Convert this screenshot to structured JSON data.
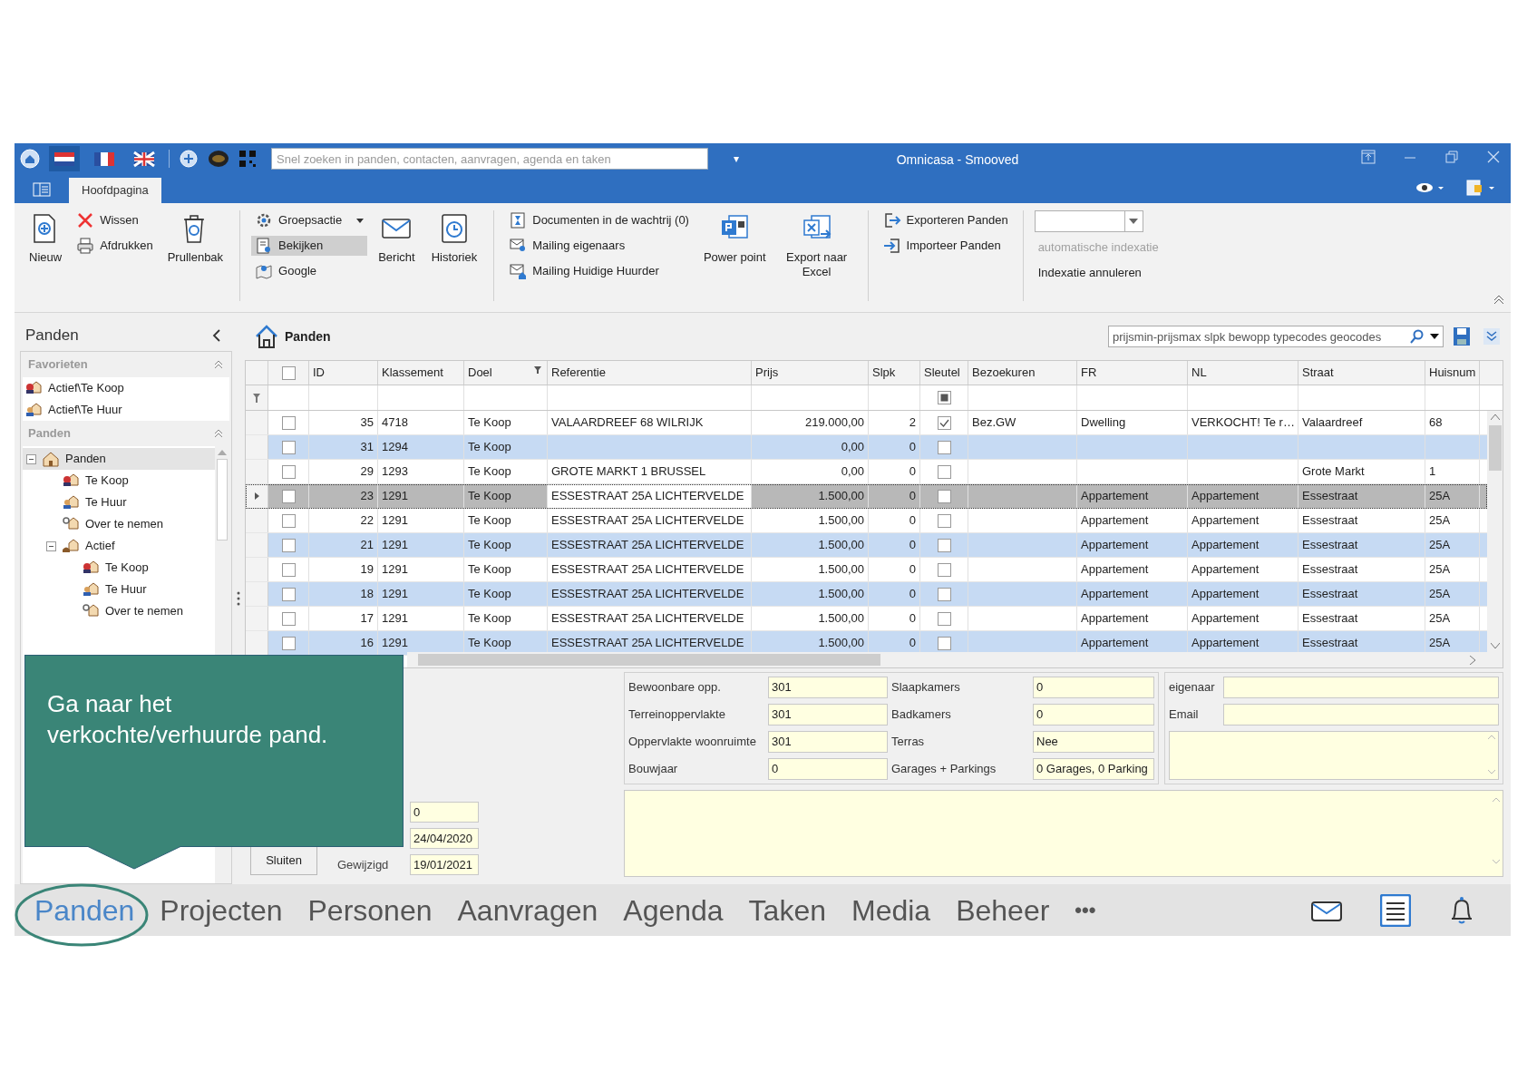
{
  "title_bar": {
    "title": "Omnicasa - Smooved",
    "languages": [
      {
        "kind": "nl",
        "selected": true
      },
      {
        "kind": "fr",
        "selected": false
      },
      {
        "kind": "uk",
        "selected": false
      }
    ],
    "search": {
      "placeholder": "Snel zoeken in panden, contacten, aanvragen, agenda en taken"
    },
    "dropdown": "▾"
  },
  "ribbon": {
    "tabs": [
      {
        "label": "Hoofdpagina",
        "selected": true
      }
    ],
    "groups": [
      {
        "items": [
          {
            "label": "Nieuw",
            "kind": "large",
            "pressed": false,
            "disabled": false
          },
          {
            "label": "Wissen",
            "kind": "small",
            "pressed": false,
            "disabled": false
          },
          {
            "label": "Afdrukken",
            "kind": "small",
            "pressed": false,
            "disabled": false
          },
          {
            "label": "Prullenbak",
            "kind": "large",
            "pressed": false,
            "disabled": false
          }
        ]
      },
      {
        "items": [
          {
            "label": "Groepsactie",
            "kind": "split",
            "pressed": false,
            "disabled": false
          },
          {
            "label": "Bekijken",
            "kind": "small",
            "pressed": true,
            "disabled": false
          },
          {
            "label": "Google",
            "kind": "small",
            "pressed": false,
            "disabled": false
          },
          {
            "label": "Bericht",
            "kind": "large",
            "pressed": false,
            "disabled": false
          },
          {
            "label": "Historiek",
            "kind": "large",
            "pressed": false,
            "disabled": false
          }
        ]
      },
      {
        "items": [
          {
            "label": "Documenten in de wachtrij (0)",
            "kind": "small",
            "pressed": false,
            "disabled": false
          },
          {
            "label": "Mailing eigenaars",
            "kind": "small",
            "pressed": false,
            "disabled": false
          },
          {
            "label": "Mailing Huidige Huurder",
            "kind": "small",
            "pressed": false,
            "disabled": false
          },
          {
            "label": "Power point",
            "kind": "large",
            "pressed": false,
            "disabled": false
          },
          {
            "label": "Export naar Excel",
            "kind": "large",
            "pressed": false,
            "disabled": false
          }
        ]
      },
      {
        "items": [
          {
            "label": "Exporteren Panden",
            "kind": "small",
            "pressed": false,
            "disabled": false
          },
          {
            "label": "Importeer Panden",
            "kind": "small",
            "pressed": false,
            "disabled": false
          }
        ]
      },
      {
        "items": [
          {
            "kind": "combo",
            "pressed": false,
            "disabled": false
          },
          {
            "label": "automatische indexatie",
            "kind": "small",
            "pressed": false,
            "disabled": true
          },
          {
            "label": "Indexatie annuleren",
            "kind": "small",
            "pressed": false,
            "disabled": false
          }
        ]
      }
    ]
  },
  "sidebar": {
    "title": "Panden",
    "favorites": {
      "title": "Favorieten",
      "items": [
        {
          "label": "Actief\\Te Koop",
          "kind": "sale"
        },
        {
          "label": "Actief\\Te Huur",
          "kind": "rent"
        }
      ]
    },
    "tree_section": {
      "title": "Panden",
      "tree": [
        {
          "label": "Panden",
          "kind": "home",
          "selected": true,
          "expanded": true,
          "children": [
            {
              "label": "Te Koop",
              "kind": "sale",
              "selected": false
            },
            {
              "label": "Te Huur",
              "kind": "rent",
              "selected": false
            },
            {
              "label": "Over te nemen",
              "kind": "takeover",
              "selected": false
            },
            {
              "label": "Actief",
              "kind": "active",
              "selected": false,
              "expanded": true,
              "children": [
                {
                  "label": "Te Koop",
                  "kind": "sale",
                  "selected": false
                },
                {
                  "label": "Te Huur",
                  "kind": "rent",
                  "selected": false
                },
                {
                  "label": "Over te nemen",
                  "kind": "takeover",
                  "selected": false
                }
              ]
            }
          ]
        }
      ]
    }
  },
  "grid": {
    "title": "Panden",
    "filter": {
      "placeholder": "prijsmin-prijsmax slpk bewopp typecodes geocodes"
    },
    "columns": [
      "ID",
      "Klassement",
      "Doel",
      "Referentie",
      "Prijs",
      "Slpk",
      "Sleutel",
      "Bezoekuren",
      "FR",
      "NL",
      "Straat",
      "Huisnum"
    ],
    "select_all": {
      "checked": false
    },
    "sleutel_filter": {
      "indeterminate": true
    },
    "rows": [
      {
        "checked": false,
        "selected": false,
        "id": "35",
        "klassement": "4718",
        "doel": "Te Koop",
        "referentie": "VALAARDREEF 68 WILRIJK",
        "prijs": "219.000,00",
        "slpk": "2",
        "sleutel": true,
        "bezoekuren": "Bez.GW",
        "fr": "Dwelling",
        "nl": "VERKOCHT! Te r…",
        "straat": "Valaardreef",
        "huisnummer": "68"
      },
      {
        "checked": false,
        "selected": false,
        "id": "31",
        "klassement": "1294",
        "doel": "Te Koop",
        "prijs": "0,00",
        "slpk": "0",
        "sleutel": false
      },
      {
        "checked": false,
        "selected": false,
        "id": "29",
        "klassement": "1293",
        "doel": "Te Koop",
        "referentie": "GROTE MARKT 1 BRUSSEL",
        "prijs": "0,00",
        "slpk": "0",
        "sleutel": false,
        "straat": "Grote Markt",
        "huisnummer": "1"
      },
      {
        "checked": false,
        "selected": true,
        "id": "23",
        "klassement": "1291",
        "doel": "Te Koop",
        "referentie": "ESSESTRAAT 25A LICHTERVELDE",
        "prijs": "1.500,00",
        "slpk": "0",
        "sleutel": false,
        "fr": "Appartement",
        "nl": "Appartement",
        "straat": "Essestraat",
        "huisnummer": "25A"
      },
      {
        "checked": false,
        "selected": false,
        "id": "22",
        "klassement": "1291",
        "doel": "Te Koop",
        "referentie": "ESSESTRAAT 25A LICHTERVELDE",
        "prijs": "1.500,00",
        "slpk": "0",
        "sleutel": false,
        "fr": "Appartement",
        "nl": "Appartement",
        "straat": "Essestraat",
        "huisnummer": "25A"
      },
      {
        "checked": false,
        "selected": false,
        "id": "21",
        "klassement": "1291",
        "doel": "Te Koop",
        "referentie": "ESSESTRAAT 25A LICHTERVELDE",
        "prijs": "1.500,00",
        "slpk": "0",
        "sleutel": false,
        "fr": "Appartement",
        "nl": "Appartement",
        "straat": "Essestraat",
        "huisnummer": "25A"
      },
      {
        "checked": false,
        "selected": false,
        "id": "19",
        "klassement": "1291",
        "doel": "Te Koop",
        "referentie": "ESSESTRAAT 25A LICHTERVELDE",
        "prijs": "1.500,00",
        "slpk": "0",
        "sleutel": false,
        "fr": "Appartement",
        "nl": "Appartement",
        "straat": "Essestraat",
        "huisnummer": "25A"
      },
      {
        "checked": false,
        "selected": false,
        "id": "18",
        "klassement": "1291",
        "doel": "Te Koop",
        "referentie": "ESSESTRAAT 25A LICHTERVELDE",
        "prijs": "1.500,00",
        "slpk": "0",
        "sleutel": false,
        "fr": "Appartement",
        "nl": "Appartement",
        "straat": "Essestraat",
        "huisnummer": "25A"
      },
      {
        "checked": false,
        "selected": false,
        "id": "17",
        "klassement": "1291",
        "doel": "Te Koop",
        "referentie": "ESSESTRAAT 25A LICHTERVELDE",
        "prijs": "1.500,00",
        "slpk": "0",
        "sleutel": false,
        "fr": "Appartement",
        "nl": "Appartement",
        "straat": "Essestraat",
        "huisnummer": "25A"
      },
      {
        "checked": false,
        "selected": false,
        "id": "16",
        "klassement": "1291",
        "doel": "Te Koop",
        "referentie": "ESSESTRAAT 25A LICHTERVELDE",
        "prijs": "1.500,00",
        "slpk": "0",
        "sleutel": false,
        "fr": "Appartement",
        "nl": "Appartement",
        "straat": "Essestraat",
        "huisnummer": "25A"
      }
    ]
  },
  "detail": {
    "left_fields": [
      {
        "value": "0"
      },
      {
        "value": "24/04/2020"
      },
      {
        "label": "Gewijzigd",
        "value": "19/01/2021"
      }
    ],
    "close_button": "Sluiten",
    "specs": [
      {
        "label": "Bewoonbare opp.",
        "value": "301"
      },
      {
        "label": "Slaapkamers",
        "value": "0"
      },
      {
        "label": "Terreinoppervlakte",
        "value": "301"
      },
      {
        "label": "Badkamers",
        "value": "0"
      },
      {
        "label": "Oppervlakte woonruimte",
        "value": "301"
      },
      {
        "label": "Terras",
        "value": "Nee"
      },
      {
        "label": "Bouwjaar",
        "value": "0"
      },
      {
        "label": "Garages + Parkings",
        "value": "0 Garages, 0 Parking"
      }
    ],
    "owner": [
      {
        "label": "eigenaar"
      },
      {
        "label": "Email"
      }
    ]
  },
  "bottom_nav": {
    "items": [
      {
        "label": "Panden",
        "selected": true
      },
      {
        "label": "Projecten",
        "selected": false
      },
      {
        "label": "Personen",
        "selected": false
      },
      {
        "label": "Aanvragen",
        "selected": false
      },
      {
        "label": "Agenda",
        "selected": false
      },
      {
        "label": "Taken",
        "selected": false
      },
      {
        "label": "Media",
        "selected": false
      },
      {
        "label": "Beheer",
        "selected": false
      }
    ],
    "more": "•••"
  },
  "callout": {
    "lines": [
      "Ga naar het",
      "verkochte/verhuurde pand."
    ]
  }
}
